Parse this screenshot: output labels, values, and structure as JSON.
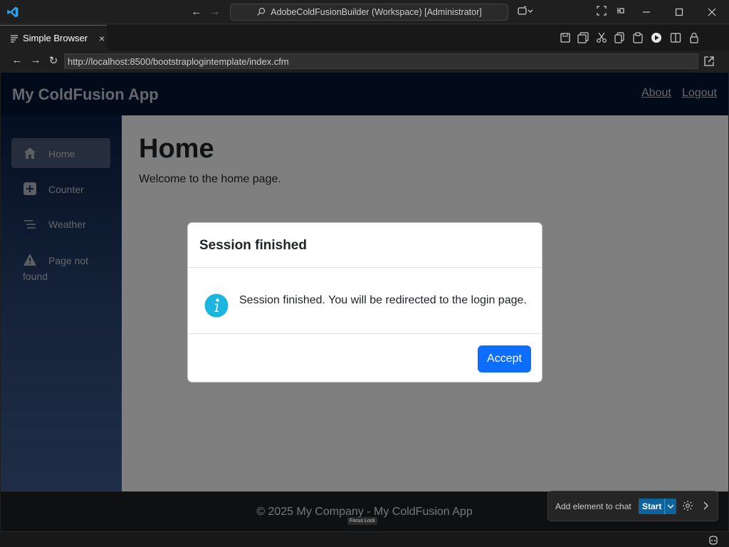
{
  "window": {
    "title": "AdobeColdFusionBuilder (Workspace) [Administrator]",
    "icons": [
      "vscode-logo",
      "back-arrow",
      "forward-arrow",
      "search-icon",
      "copilot-icon",
      "layout-icon",
      "pin-icon",
      "minimize-icon",
      "maximize-icon",
      "close-icon"
    ]
  },
  "editor": {
    "tab_label": "Simple Browser",
    "tab_close": "×",
    "actions": [
      "save-icon",
      "save-all-icon",
      "cut-icon",
      "copy-icon",
      "paste-icon",
      "run-icon",
      "split-editor-icon",
      "lock-icon"
    ]
  },
  "browser": {
    "url": "http://localhost:8500/bootstraplogintemplate/index.cfm"
  },
  "app": {
    "brand": "My ColdFusion App",
    "top_links": {
      "about": "About",
      "logout": "Logout"
    },
    "nav": [
      {
        "label": "Home",
        "icon": "home-icon",
        "active": true
      },
      {
        "label": "Counter",
        "icon": "plus-square-icon",
        "active": false
      },
      {
        "label": "Weather",
        "icon": "list-icon",
        "active": false
      },
      {
        "label": "Page not found",
        "label_line1": "Page not",
        "label_line2": "found",
        "icon": "warning-icon",
        "active": false
      }
    ],
    "page_title": "Home",
    "page_text": "Welcome to the home page.",
    "footer": "© 2025 My Company - My ColdFusion App"
  },
  "modal": {
    "title": "Session finished",
    "message": "Session finished. You will be redirected to the login page.",
    "icon": "info-icon",
    "accept_label": "Accept"
  },
  "chat_widget": {
    "label": "Add element to chat",
    "start_label": "Start",
    "focus_lock": "Focus Lock"
  },
  "colors": {
    "app_header": "#051734",
    "modal_button": "#0d6efd",
    "info_icon": "#1bb6e0",
    "vscode_accent": "#0078d4"
  }
}
